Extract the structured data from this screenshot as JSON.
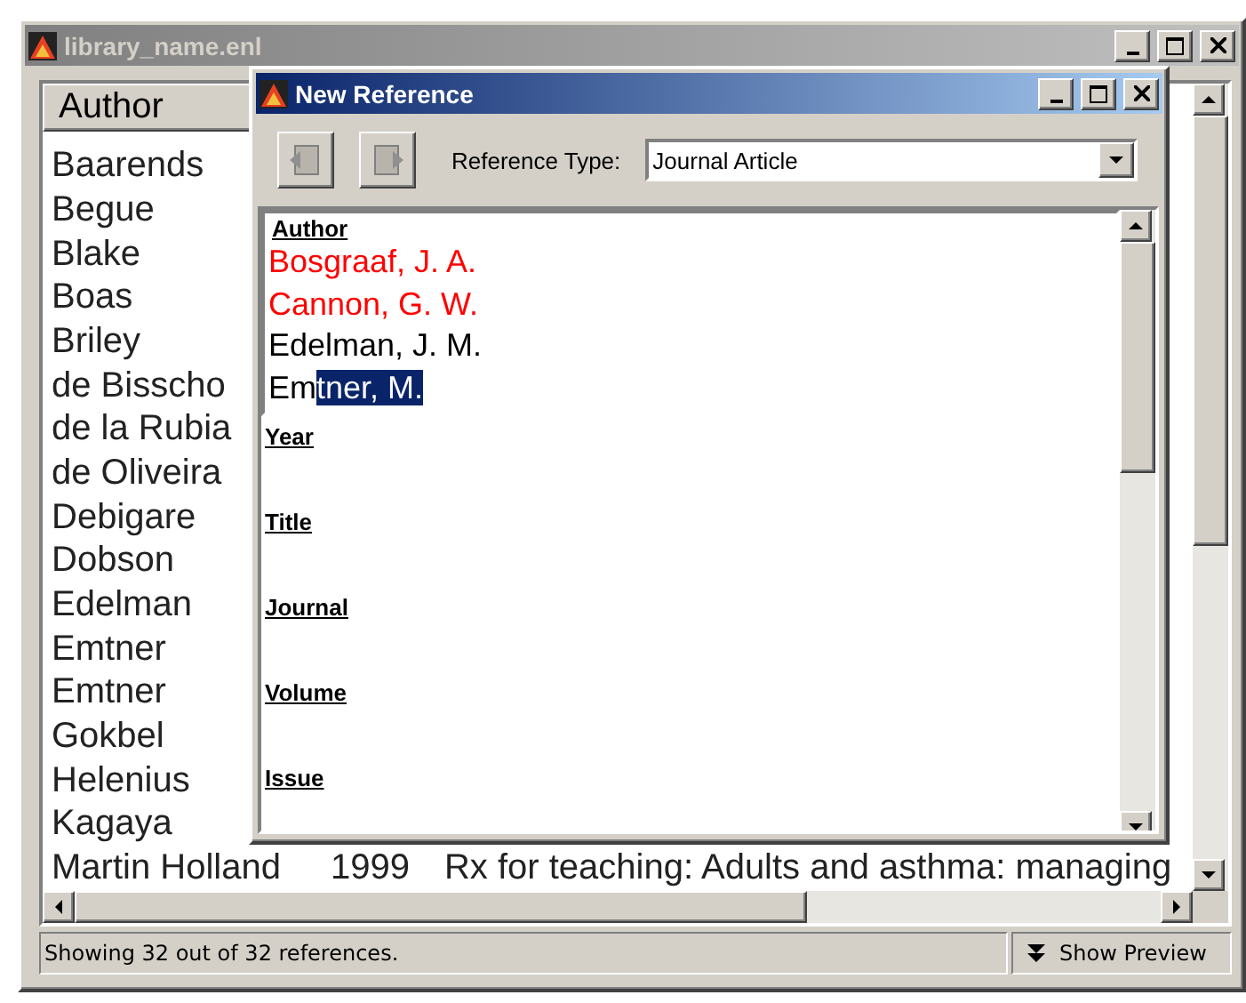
{
  "library_window": {
    "title": "library_name.enl",
    "columns": [
      "Author"
    ],
    "rows": [
      {
        "author": "Baarends"
      },
      {
        "author": "Begue"
      },
      {
        "author": "Blake"
      },
      {
        "author": "Boas"
      },
      {
        "author": "Briley"
      },
      {
        "author": "de Bisscho"
      },
      {
        "author": "de la Rubia"
      },
      {
        "author": "de Oliveira"
      },
      {
        "author": "Debigare"
      },
      {
        "author": "Dobson"
      },
      {
        "author": "Edelman"
      },
      {
        "author": "Emtner"
      },
      {
        "author": "Emtner"
      },
      {
        "author": "Gokbel"
      },
      {
        "author": "Helenius"
      },
      {
        "author": "Kagaya"
      },
      {
        "author": "Martin Holland",
        "year": "1999",
        "title": "Rx for teaching: Adults and asthma: managing"
      }
    ],
    "status_bar": {
      "text": "Showing 32 out of 32 references.",
      "preview_button": "Show Preview"
    }
  },
  "dialog": {
    "title": "New Reference",
    "reference_type_label": "Reference Type:",
    "reference_type": "Journal Article",
    "author_lines": [
      {
        "color": "#ff0000",
        "segments": [
          {
            "text": "Bosgraaf, J. A.",
            "selected": false
          }
        ]
      },
      {
        "color": "#ff0000",
        "segments": [
          {
            "text": "Cannon, G. W.",
            "selected": false
          }
        ]
      },
      {
        "color": "#000000",
        "segments": [
          {
            "text": "Edelman, J. M.",
            "selected": false
          }
        ]
      },
      {
        "color": "#000000",
        "segments": [
          {
            "text": "Em",
            "selected": false
          },
          {
            "text": "tner, M.",
            "selected": true
          }
        ]
      }
    ],
    "fields": [
      {
        "label": "Author"
      },
      {
        "label": "Year"
      },
      {
        "label": "Title"
      },
      {
        "label": "Journal"
      },
      {
        "label": "Volume"
      },
      {
        "label": "Issue"
      }
    ]
  }
}
